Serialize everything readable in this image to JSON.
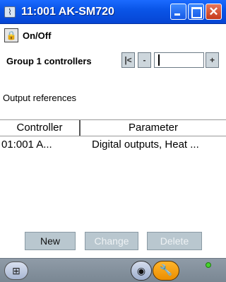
{
  "window": {
    "title": "11:001 AK-SM720",
    "icon": "app-icon"
  },
  "titlebar_buttons": [
    {
      "name": "minimize",
      "icon": "minimize-icon"
    },
    {
      "name": "maximize",
      "icon": "maximize-icon"
    },
    {
      "name": "close",
      "icon": "close-icon",
      "glyph": "✕"
    }
  ],
  "header": {
    "icon": "lock-icon",
    "icon_glyph": "🔒",
    "label": "On/Off"
  },
  "group": {
    "label": "Group 1 controllers",
    "nav": {
      "first_icon": "first-record-icon",
      "first_glyph": "|<",
      "prev_icon": "previous-icon",
      "prev_glyph": "-",
      "next_icon": "next-icon",
      "next_glyph": "+",
      "value": ""
    }
  },
  "section": {
    "title": "Output references"
  },
  "table": {
    "columns": [
      "Controller",
      "Parameter"
    ],
    "rows": [
      [
        "01:001 A...",
        "Digital outputs, Heat ..."
      ]
    ]
  },
  "actions": {
    "new_label": "New",
    "change_label": "Change",
    "delete_label": "Delete"
  },
  "bottombar": {
    "tree_icon": "tree-icon",
    "tree_glyph": "⊞",
    "camera_icon": "camera-icon",
    "camera_glyph": "◉",
    "wrench_icon": "wrench-icon",
    "wrench_glyph": "🔧",
    "status_color": "#46d22c"
  },
  "colors": {
    "titlebar": "#0a55e8",
    "close": "#c63a1c",
    "button_face": "#b9c7cf",
    "bottombar": "#8f9ba7",
    "accent_orange": "#ec8e00"
  }
}
